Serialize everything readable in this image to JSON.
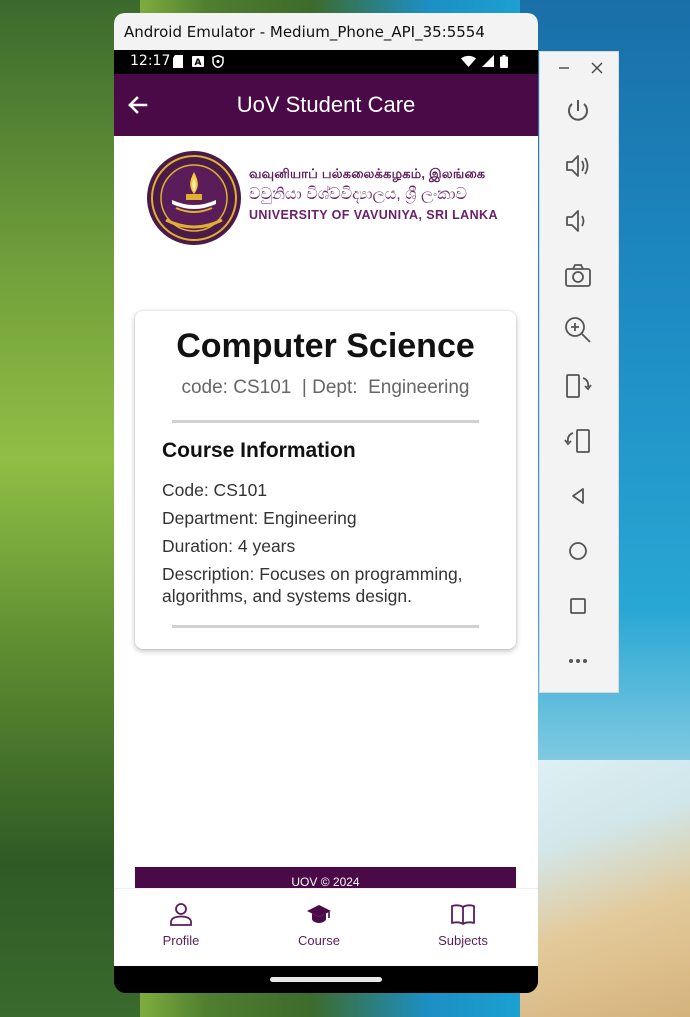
{
  "window": {
    "title": "Android Emulator - Medium_Phone_API_35:5554"
  },
  "status_bar": {
    "time": "12:17",
    "left_icons": [
      "sd-card-icon",
      "a-icon",
      "shield-icon"
    ],
    "right_icons": [
      "wifi-icon",
      "signal-icon",
      "battery-icon"
    ]
  },
  "app_bar": {
    "title": "UoV Student Care",
    "back_icon": "arrow-left-icon"
  },
  "logo": {
    "line1": "வவுனியாப் பல்கலைக்கழகம், இலங்கை",
    "line2": "වවුනියා විශ්වවිද්‍යාලය, ශ්‍රී ලංකාව",
    "line3": "UNIVERSITY OF VAVUNIYA, SRI LANKA"
  },
  "course": {
    "title": "Computer Science",
    "subtitle": "code: CS101  | Dept:  Engineering",
    "info_heading": "Course Information",
    "code": "Code: CS101",
    "department": "Department: Engineering",
    "duration": "Duration: 4 years",
    "description": "Description: Focuses on programming, algorithms, and systems design."
  },
  "footer": {
    "text": "UOV © 2024"
  },
  "bottom_nav": {
    "items": [
      {
        "label": "Profile",
        "icon": "person-icon"
      },
      {
        "label": "Course",
        "icon": "graduation-cap-icon"
      },
      {
        "label": "Subjects",
        "icon": "book-icon"
      }
    ]
  },
  "side_toolbar": {
    "buttons": [
      "power-icon",
      "volume-up-icon",
      "volume-down-icon",
      "camera-icon",
      "zoom-in-icon",
      "rotate-left-icon",
      "rotate-right-icon",
      "back-icon",
      "home-icon",
      "overview-icon",
      "more-icon"
    ]
  },
  "colors": {
    "brand": "#4a0a48",
    "nav_label": "#5a1d5a",
    "card_bg": "#ffffff"
  }
}
